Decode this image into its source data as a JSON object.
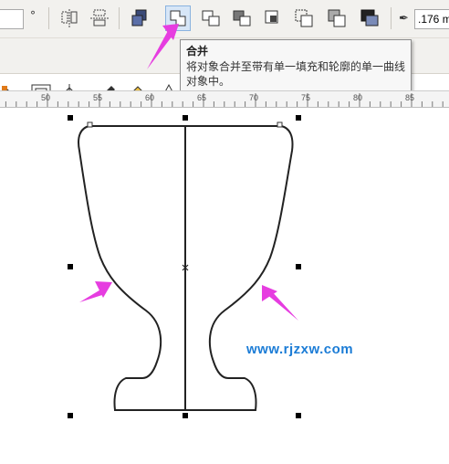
{
  "toolbar": {
    "top_left_value": "",
    "degree_symbol": "°",
    "outline_width": ".176 m",
    "pen_icon": "outline-pen-icon"
  },
  "tooltip": {
    "title": "合并",
    "description": "将对象合并至带有单一填充和轮廓的单一曲线对象中。"
  },
  "ruler": {
    "labels": [
      "50",
      "55",
      "60",
      "65",
      "70",
      "75",
      "80",
      "85"
    ]
  },
  "canvas": {
    "watermark": "www.rjzxw.com"
  },
  "colors": {
    "accent": "#e63de0",
    "selection_active_bg": "#d7e6f7",
    "watermark": "#1b7cd6"
  }
}
